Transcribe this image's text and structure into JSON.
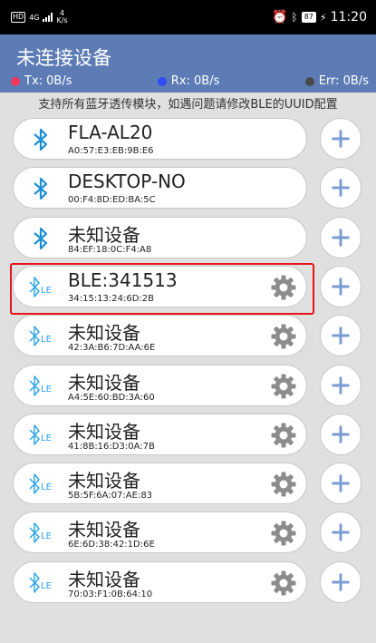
{
  "status_bar": {
    "hd": "HD",
    "network": "4G",
    "speed_value": "4",
    "speed_unit": "K/s",
    "battery": "87",
    "time": "11:20",
    "icons": [
      "alarm-icon",
      "bluetooth-icon",
      "battery-icon",
      "charging-icon"
    ]
  },
  "header": {
    "title": "未连接设备",
    "tx": "Tx: 0B/s",
    "rx": "Rx: 0B/s",
    "err": "Err: 0B/s",
    "tx_color": "#f2355d",
    "rx_color": "#2d4bf0",
    "err_color": "#4a4a4a"
  },
  "hint": "支持所有蓝牙透传模块，如遇问题请修改BLE的UUID配置",
  "devices": [
    {
      "name": "FLA-AL20",
      "mac": "A0:57:E3:EB:9B:E6",
      "type": "classic",
      "settings": false
    },
    {
      "name": "DESKTOP-NO",
      "mac": "00:F4:8D:ED:BA:5C",
      "type": "classic",
      "settings": false
    },
    {
      "name": "未知设备",
      "mac": "84:EF:18:0C:F4:A8",
      "type": "classic",
      "settings": false
    },
    {
      "name": "BLE:341513",
      "mac": "34:15:13:24:6D:2B",
      "type": "ble",
      "settings": true
    },
    {
      "name": "未知设备",
      "mac": "42:3A:B6:7D:AA:6E",
      "type": "ble",
      "settings": true
    },
    {
      "name": "未知设备",
      "mac": "A4:5E:60:BD:3A:60",
      "type": "ble",
      "settings": true
    },
    {
      "name": "未知设备",
      "mac": "41:8B:16:D3:0A:7B",
      "type": "ble",
      "settings": true
    },
    {
      "name": "未知设备",
      "mac": "5B:5F:6A:07:AE:83",
      "type": "ble",
      "settings": true
    },
    {
      "name": "未知设备",
      "mac": "6E:6D:38:42:1D:6E",
      "type": "ble",
      "settings": true
    },
    {
      "name": "未知设备",
      "mac": "70:03:F1:0B:64:10",
      "type": "ble",
      "settings": true
    }
  ],
  "colors": {
    "accent_blue": "#5d7cb5",
    "bt_classic": "#1d8fd6",
    "bt_ble": "#27a3e8",
    "plus": "#7b9bd4",
    "gear": "#8c8c8c",
    "highlight": "#e8141c"
  },
  "icon_names": {
    "classic": "bluetooth-icon",
    "ble": "bluetooth-le-icon",
    "settings": "gear-icon",
    "connect": "plus-icon"
  }
}
